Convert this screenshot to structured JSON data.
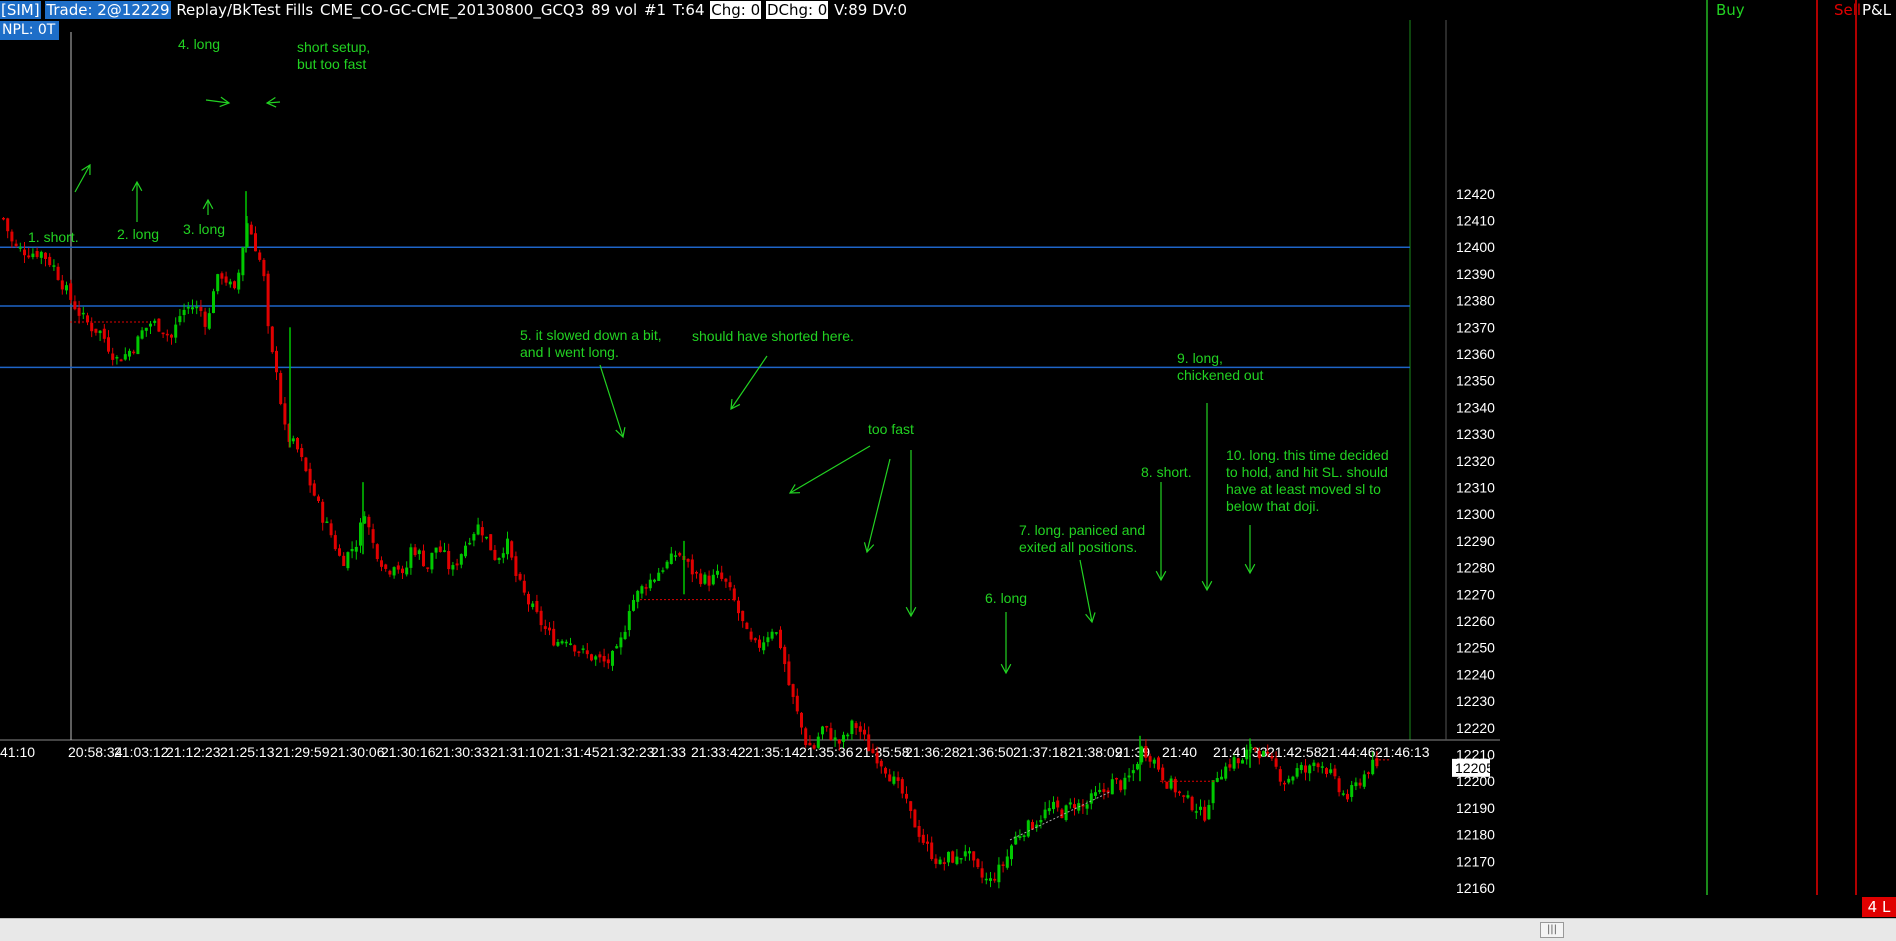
{
  "header": {
    "sim": "[SIM]",
    "trade": "Trade: 2@12229",
    "mode": "Replay/BkTest Fills",
    "instrument": "CME_CO-GC-CME_20130800_GCQ3",
    "vol": "89 vol",
    "bar_no": "#1",
    "ticks": "T:64",
    "chg": "Chg: 0",
    "dchg": "DChg: 0",
    "v": "V:89 DV:0",
    "npl": "NPL: 0T"
  },
  "columns": {
    "buy": "Buy",
    "sell": "Sell",
    "pnl": "P&L"
  },
  "position_badge": "4 L",
  "scrollbar_grip": "|||",
  "colors": {
    "up": "#00c800",
    "down": "#e00000",
    "annotation": "#22d222",
    "hline": "#1e64c8",
    "accent": "#1e6ec8"
  },
  "chart_data": {
    "type": "candlestick",
    "title": "",
    "ylim": [
      12155,
      12425
    ],
    "yticks": [
      12420,
      12410,
      12400,
      12390,
      12380,
      12370,
      12360,
      12350,
      12340,
      12330,
      12320,
      12310,
      12300,
      12290,
      12280,
      12270,
      12260,
      12250,
      12240,
      12230,
      12220,
      12210,
      12200,
      12190,
      12180,
      12170,
      12160
    ],
    "xticks": [
      "41:10",
      "20:58:34",
      "21:03:12",
      "21:12:23",
      "21:25:13",
      "21:29:59",
      "21:30:06",
      "21:30:16",
      "21:30:33",
      "21:31:10",
      "21:31:45",
      "21:32:23",
      "21:33",
      "21:33:42",
      "21:35:14",
      "21:35:36",
      "21:35:58",
      "21:36:28",
      "21:36:50",
      "21:37:18",
      "21:38:09",
      "21:39",
      "21:40",
      "21:41:33",
      "21:42:58",
      "21:44:46",
      "21:46:13"
    ],
    "last_price": "12205",
    "horizontal_lines": [
      12400,
      12378,
      12355
    ],
    "close_path": [
      [
        0,
        12413
      ],
      [
        12,
        12400
      ],
      [
        28,
        12398
      ],
      [
        40,
        12398
      ],
      [
        52,
        12393
      ],
      [
        60,
        12387
      ],
      [
        70,
        12380
      ],
      [
        80,
        12374
      ],
      [
        90,
        12370
      ],
      [
        100,
        12368
      ],
      [
        108,
        12362
      ],
      [
        115,
        12358
      ],
      [
        125,
        12360
      ],
      [
        135,
        12364
      ],
      [
        140,
        12368
      ],
      [
        150,
        12372
      ],
      [
        160,
        12370
      ],
      [
        170,
        12366
      ],
      [
        180,
        12376
      ],
      [
        190,
        12378
      ],
      [
        200,
        12376
      ],
      [
        206,
        12370
      ],
      [
        212,
        12385
      ],
      [
        220,
        12390
      ],
      [
        228,
        12386
      ],
      [
        234,
        12382
      ],
      [
        240,
        12398
      ],
      [
        246,
        12410
      ],
      [
        250,
        12405
      ],
      [
        256,
        12398
      ],
      [
        262,
        12390
      ],
      [
        266,
        12370
      ],
      [
        270,
        12360
      ],
      [
        275,
        12355
      ],
      [
        280,
        12340
      ],
      [
        284,
        12330
      ],
      [
        290,
        12327
      ],
      [
        296,
        12324
      ],
      [
        302,
        12318
      ],
      [
        310,
        12310
      ],
      [
        320,
        12300
      ],
      [
        330,
        12292
      ],
      [
        340,
        12282
      ],
      [
        348,
        12286
      ],
      [
        356,
        12290
      ],
      [
        363,
        12302
      ],
      [
        370,
        12290
      ],
      [
        378,
        12284
      ],
      [
        386,
        12278
      ],
      [
        394,
        12283
      ],
      [
        402,
        12275
      ],
      [
        410,
        12288
      ],
      [
        418,
        12285
      ],
      [
        426,
        12280
      ],
      [
        434,
        12288
      ],
      [
        442,
        12285
      ],
      [
        450,
        12278
      ],
      [
        460,
        12286
      ],
      [
        470,
        12293
      ],
      [
        478,
        12296
      ],
      [
        486,
        12290
      ],
      [
        495,
        12283
      ],
      [
        505,
        12290
      ],
      [
        515,
        12276
      ],
      [
        525,
        12268
      ],
      [
        535,
        12262
      ],
      [
        545,
        12256
      ],
      [
        555,
        12252
      ],
      [
        565,
        12254
      ],
      [
        575,
        12250
      ],
      [
        585,
        12247
      ],
      [
        595,
        12246
      ],
      [
        605,
        12244
      ],
      [
        615,
        12248
      ],
      [
        622,
        12255
      ],
      [
        628,
        12266
      ],
      [
        636,
        12270
      ],
      [
        644,
        12274
      ],
      [
        652,
        12276
      ],
      [
        660,
        12280
      ],
      [
        668,
        12282
      ],
      [
        676,
        12286
      ],
      [
        684,
        12282
      ],
      [
        692,
        12278
      ],
      [
        700,
        12276
      ],
      [
        708,
        12275
      ],
      [
        716,
        12277
      ],
      [
        724,
        12274
      ],
      [
        732,
        12268
      ],
      [
        740,
        12260
      ],
      [
        748,
        12252
      ],
      [
        756,
        12250
      ],
      [
        764,
        12254
      ],
      [
        772,
        12258
      ],
      [
        780,
        12250
      ],
      [
        788,
        12235
      ],
      [
        796,
        12225
      ],
      [
        804,
        12215
      ],
      [
        812,
        12212
      ],
      [
        820,
        12220
      ],
      [
        828,
        12218
      ],
      [
        836,
        12214
      ],
      [
        844,
        12216
      ],
      [
        852,
        12222
      ],
      [
        860,
        12218
      ],
      [
        868,
        12212
      ],
      [
        876,
        12209
      ],
      [
        884,
        12205
      ],
      [
        892,
        12200
      ],
      [
        900,
        12196
      ],
      [
        908,
        12188
      ],
      [
        916,
        12182
      ],
      [
        924,
        12176
      ],
      [
        932,
        12172
      ],
      [
        940,
        12168
      ],
      [
        948,
        12172
      ],
      [
        956,
        12170
      ],
      [
        964,
        12175
      ],
      [
        972,
        12168
      ],
      [
        980,
        12164
      ],
      [
        988,
        12162
      ],
      [
        996,
        12166
      ],
      [
        1004,
        12170
      ],
      [
        1012,
        12178
      ],
      [
        1022,
        12182
      ],
      [
        1032,
        12184
      ],
      [
        1042,
        12188
      ],
      [
        1052,
        12190
      ],
      [
        1062,
        12188
      ],
      [
        1072,
        12192
      ],
      [
        1082,
        12190
      ],
      [
        1092,
        12194
      ],
      [
        1102,
        12196
      ],
      [
        1112,
        12200
      ],
      [
        1122,
        12198
      ],
      [
        1132,
        12204
      ],
      [
        1140,
        12212
      ],
      [
        1148,
        12210
      ],
      [
        1156,
        12206
      ],
      [
        1164,
        12200
      ],
      [
        1172,
        12198
      ],
      [
        1180,
        12194
      ],
      [
        1188,
        12192
      ],
      [
        1196,
        12190
      ],
      [
        1202,
        12186
      ],
      [
        1208,
        12194
      ],
      [
        1216,
        12203
      ],
      [
        1224,
        12205
      ],
      [
        1232,
        12208
      ],
      [
        1240,
        12206
      ],
      [
        1250,
        12214
      ],
      [
        1258,
        12211
      ],
      [
        1266,
        12208
      ],
      [
        1274,
        12205
      ],
      [
        1282,
        12200
      ],
      [
        1290,
        12202
      ],
      [
        1298,
        12205
      ],
      [
        1306,
        12203
      ],
      [
        1314,
        12208
      ],
      [
        1322,
        12206
      ],
      [
        1330,
        12202
      ],
      [
        1338,
        12196
      ],
      [
        1346,
        12194
      ],
      [
        1354,
        12198
      ],
      [
        1362,
        12202
      ],
      [
        1370,
        12206
      ],
      [
        1378,
        12204
      ]
    ],
    "annotations": [
      {
        "text": "1. short.",
        "dx": 28,
        "dy": 242
      },
      {
        "text": "2. long",
        "dx": 117,
        "dy": 239
      },
      {
        "text": "3. long",
        "dx": 183,
        "dy": 234
      },
      {
        "text": "4. long",
        "dx": 178,
        "dy": 49
      },
      {
        "text": "short setup,",
        "dx": 297,
        "dy": 52
      },
      {
        "text": "but too fast",
        "dx": 297,
        "dy": 69
      },
      {
        "text": "5. it slowed down a bit,",
        "dx": 520,
        "dy": 340
      },
      {
        "text": "and I went long.",
        "dx": 520,
        "dy": 357
      },
      {
        "text": "should have shorted here.",
        "dx": 692,
        "dy": 341
      },
      {
        "text": "too fast",
        "dx": 868,
        "dy": 434
      },
      {
        "text": "6. long",
        "dx": 985,
        "dy": 603
      },
      {
        "text": "7. long. paniced and",
        "dx": 1019,
        "dy": 535
      },
      {
        "text": "exited all positions.",
        "dx": 1019,
        "dy": 552
      },
      {
        "text": "8. short.",
        "dx": 1141,
        "dy": 477
      },
      {
        "text": "9. long,",
        "dx": 1177,
        "dy": 363
      },
      {
        "text": "chickened out",
        "dx": 1177,
        "dy": 380
      },
      {
        "text": "10. long. this time decided",
        "dx": 1226,
        "dy": 460
      },
      {
        "text": "to hold, and hit SL. should",
        "dx": 1226,
        "dy": 477
      },
      {
        "text": "have at least moved sl to",
        "dx": 1226,
        "dy": 494
      },
      {
        "text": "below that doji.",
        "dx": 1226,
        "dy": 511
      }
    ],
    "arrows": [
      [
        75,
        192,
        90,
        165
      ],
      [
        137,
        222,
        137,
        182
      ],
      [
        208,
        215,
        208,
        200
      ],
      [
        206,
        100,
        229,
        103
      ],
      [
        280,
        102,
        267,
        103
      ],
      [
        600,
        365,
        623,
        437
      ],
      [
        767,
        356,
        731,
        409
      ],
      [
        870,
        446,
        790,
        493
      ],
      [
        890,
        459,
        867,
        552
      ],
      [
        911,
        450,
        911,
        616
      ],
      [
        1006,
        612,
        1006,
        673
      ],
      [
        1080,
        560,
        1092,
        622
      ],
      [
        1161,
        482,
        1161,
        580
      ],
      [
        1207,
        403,
        1207,
        590
      ],
      [
        1250,
        525,
        1250,
        573
      ]
    ]
  }
}
